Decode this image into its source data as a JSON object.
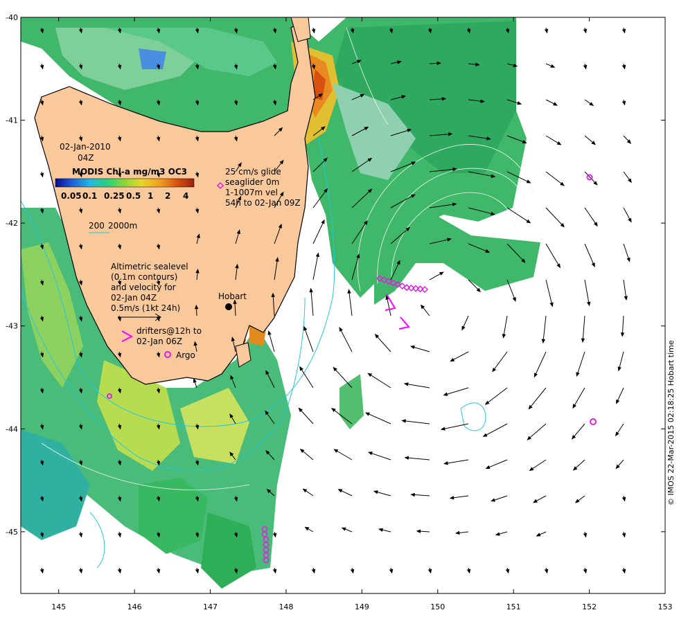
{
  "map": {
    "date_line1": "02-Jan-2010",
    "date_line2": "04Z",
    "product_title": "MODIS Chl-a mg/m3 OC3",
    "colorbar_ticks": [
      "0.05",
      "0.1",
      "0.25",
      "0.5",
      "1",
      "2",
      "4"
    ],
    "colorbar_colors": [
      "#0a0a8c",
      "#1e5fd6",
      "#22b8e0",
      "#2ccf7a",
      "#8fd63a",
      "#e6d62a",
      "#f0a020",
      "#d85010",
      "#9a2010"
    ],
    "isobath_label_1": "200",
    "isobath_label_2": "2000m",
    "glider_label_lines": [
      "25 cm/s glide",
      "seaglider 0m",
      "1-1007m vel",
      "54h to 02-Jan 09Z"
    ],
    "altimetry_lines": [
      "Altimetric sealevel",
      "(0.1m contours)",
      "and velocity for",
      "02-Jan 04Z",
      "0.5m/s (1kt 24h)"
    ],
    "drifter_label_lines": [
      "drifters@12h to",
      "02-Jan 06Z"
    ],
    "argo_label": "Argo",
    "city_label": "Hobart",
    "credit": "© IMOS 22-Mar-2015 02:18:25 Hobart time",
    "x_ticks": [
      "145",
      "146",
      "147",
      "148",
      "149",
      "150",
      "151",
      "152",
      "153"
    ],
    "y_ticks": [
      "-40",
      "-41",
      "-42",
      "-43",
      "-44",
      "-45"
    ],
    "colors": {
      "land": "#f9c89b",
      "coast": "#000000",
      "isobath": "#20c8e0",
      "contour": "#e8f0f0",
      "glider": "#e020e0",
      "drifter": "#ff00ff",
      "argo": "#e020e0"
    }
  }
}
